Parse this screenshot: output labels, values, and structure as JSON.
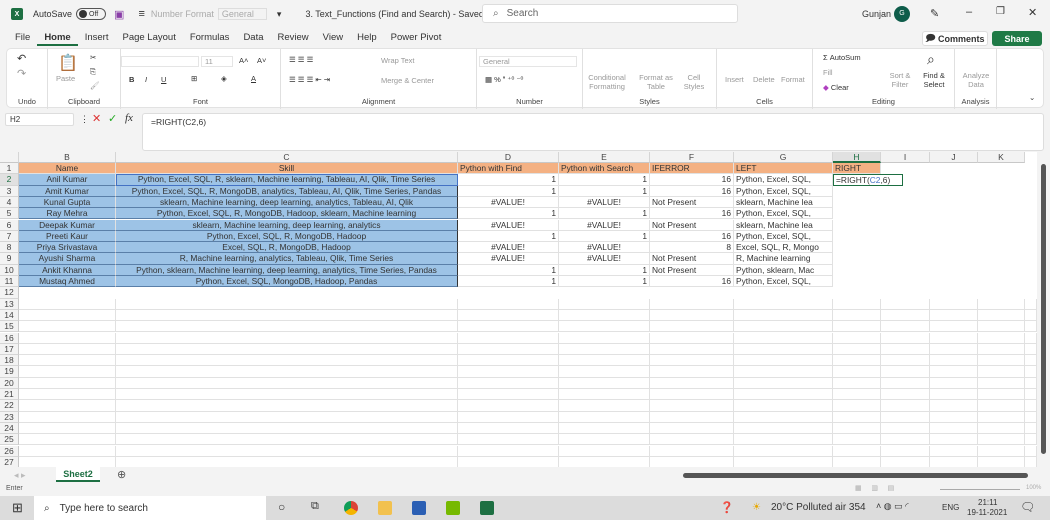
{
  "titlebar": {
    "autosave": "AutoSave",
    "toggle": "Off",
    "number_format_label": "Number Format",
    "number_format_value": "General",
    "doc_title": "3. Text_Functions (Find and Search)  -  Saved",
    "search_placeholder": "Search",
    "user": "Gunjan",
    "avatar_initial": "G"
  },
  "menu_tabs": [
    "File",
    "Home",
    "Insert",
    "Page Layout",
    "Formulas",
    "Data",
    "Review",
    "View",
    "Help",
    "Power Pivot"
  ],
  "active_tab": "Home",
  "buttons": {
    "comments": "Comments",
    "share": "Share"
  },
  "ribbon": {
    "groups": [
      "Undo",
      "Clipboard",
      "Font",
      "Alignment",
      "Number",
      "Styles",
      "Cells",
      "Editing",
      "Analysis"
    ],
    "paste": "Paste",
    "font_size": "11",
    "wrap_text": "Wrap Text",
    "merge_center": "Merge & Center",
    "number_format": "General",
    "conditional_formatting": "Conditional Formatting",
    "format_as_table": "Format as Table",
    "cell_styles": "Cell Styles",
    "insert": "Insert",
    "delete": "Delete",
    "format": "Format",
    "autosum": "AutoSum",
    "fill": "Fill",
    "clear": "Clear",
    "sort_filter": "Sort & Filter",
    "find_select": "Find & Select",
    "analyze_data": "Analyze Data"
  },
  "formula_bar": {
    "name_box": "H2",
    "formula": "=RIGHT(C2,6)"
  },
  "columns": [
    "B",
    "C",
    "D",
    "E",
    "F",
    "G",
    "H",
    "I",
    "J",
    "K"
  ],
  "active_column": "H",
  "header_row": [
    "Name",
    "Skill",
    "Python with Find",
    "Python with Search",
    "IFERROR",
    "LEFT",
    "RIGHT"
  ],
  "rows": [
    [
      "Anil Kumar",
      "Python, Excel, SQL, R, sklearn, Machine learning, Tableau, AI, Qlik, Time Series",
      "1",
      "1",
      "16",
      "Python, Excel, SQL,"
    ],
    [
      "Amit Kumar",
      "Python, Excel, SQL, R, MongoDB, analytics, Tableau, AI, Qlik, Time Series, Pandas",
      "1",
      "1",
      "16",
      "Python, Excel, SQL,"
    ],
    [
      "Kunal Gupta",
      "sklearn, Machine learning, deep learning, analytics, Tableau, AI, Qlik",
      "#VALUE!",
      "#VALUE!",
      "Not Present",
      "sklearn, Machine lea"
    ],
    [
      "Ray Mehra",
      "Python, Excel, SQL, R, MongoDB, Hadoop, sklearn, Machine learning",
      "1",
      "1",
      "16",
      "Python, Excel, SQL,"
    ],
    [
      "Deepak Kumar",
      "sklearn, Machine learning, deep learning, analytics",
      "#VALUE!",
      "#VALUE!",
      "Not Present",
      "sklearn, Machine lea"
    ],
    [
      "Preeti Kaur",
      "Python, Excel, SQL, R, MongoDB, Hadoop",
      "1",
      "1",
      "16",
      "Python, Excel, SQL,"
    ],
    [
      "Priya Srivastava",
      "Excel, SQL, R, MongoDB, Hadoop",
      "#VALUE!",
      "#VALUE!",
      "8",
      "Excel, SQL, R, Mongo"
    ],
    [
      "Ayushi Sharma",
      "R, Machine learning, analytics, Tableau, Qlik, Time Series",
      "#VALUE!",
      "#VALUE!",
      "Not Present",
      " R, Machine learning"
    ],
    [
      "Ankit Khanna",
      "Python, sklearn, Machine learning, deep learning, analytics, Time Series, Pandas",
      "1",
      "1",
      "Not Present",
      "Python, sklearn, Mac"
    ],
    [
      "Mustaq Ahmed",
      "Python, Excel, SQL, MongoDB, Hadoop, Pandas",
      "1",
      "1",
      "16",
      "Python, Excel, SQL,"
    ]
  ],
  "editing_cell": {
    "prefix": "=RIGHT(",
    "ref": "C2",
    "suffix": ",6)"
  },
  "row_numbers": [
    "1",
    "2",
    "3",
    "4",
    "5",
    "6",
    "7",
    "8",
    "9",
    "10",
    "11",
    "12",
    "13",
    "14",
    "15",
    "16",
    "17",
    "18",
    "19",
    "20",
    "21",
    "22",
    "23",
    "24",
    "25",
    "26",
    "27"
  ],
  "sheet_tab": "Sheet2",
  "status": {
    "mode": "Enter",
    "zoom": "100%"
  },
  "taskbar": {
    "search_placeholder": "Type here to search",
    "weather": "20°C  Polluted air 354",
    "lang": "ENG",
    "time": "21:11",
    "date": "19-11-2021"
  },
  "colors": {
    "header_fill": "#f4b183",
    "selection_fill": "#9dc3e6",
    "excel_green": "#1d6f42",
    "ref_blue": "#4472c4"
  }
}
